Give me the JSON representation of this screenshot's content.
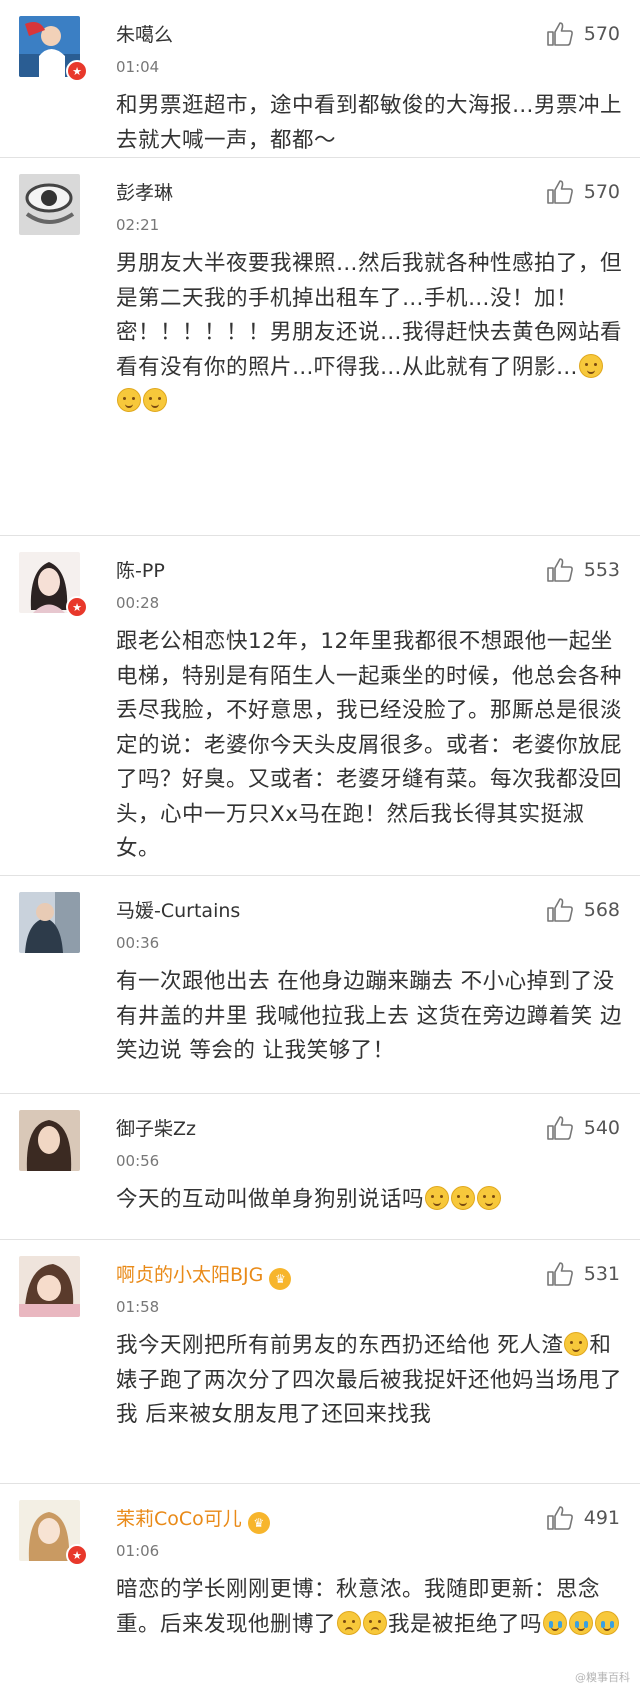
{
  "comments": [
    {
      "name": "朱噶么",
      "time": "01:04",
      "likes": "570",
      "text": "和男票逛超市，途中看到都敏俊的大海报…男票冲上去就大喊一声，都都～",
      "verified": true,
      "crown": false,
      "emoji_count": 0
    },
    {
      "name": "彭孝琳",
      "time": "02:21",
      "likes": "570",
      "text": "男朋友大半夜要我裸照…然后我就各种性感拍了，但是第二天我的手机掉出租车了…手机…没！加！密！！！！！！男朋友还说…我得赶快去黄色网站看看有没有你的照片…吓得我…从此就有了阴影…",
      "verified": false,
      "crown": false,
      "emoji_count": 3
    },
    {
      "name": "陈-PP",
      "time": "00:28",
      "likes": "553",
      "text": "跟老公相恋快12年，12年里我都很不想跟他一起坐电梯，特别是有陌生人一起乘坐的时候，他总会各种丢尽我脸，不好意思，我已经没脸了。那厮总是很淡定的说：老婆你今天头皮屑很多。或者：老婆你放屁了吗？好臭。又或者：老婆牙缝有菜。每次我都没回头，心中一万只Xx马在跑！然后我长得其实挺淑女。",
      "verified": true,
      "crown": false,
      "emoji_count": 0
    },
    {
      "name": "马媛-Curtains",
      "time": "00:36",
      "likes": "568",
      "text": "有一次跟他出去 在他身边蹦来蹦去 不小心掉到了没有井盖的井里  我喊他拉我上去  这货在旁边蹲着笑  边笑边说  等会的 让我笑够了！",
      "verified": false,
      "crown": false,
      "emoji_count": 0
    },
    {
      "name": "御子柴Zz",
      "time": "00:56",
      "likes": "540",
      "text": "今天的互动叫做单身狗别说话吗",
      "verified": false,
      "crown": false,
      "emoji_count": 3
    },
    {
      "name": "啊贞的小太阳BJG",
      "time": "01:58",
      "likes": "531",
      "text_a": "我今天刚把所有前男友的东西扔还给他 死人渣",
      "text_b": "和婊子跑了两次分了四次最后被我捉奸还他妈当场甩了我 后来被女朋友甩了还回来找我",
      "verified": false,
      "crown": true
    },
    {
      "name": "茉莉CoCo可儿",
      "time": "01:06",
      "likes": "491",
      "text_a": "暗恋的学长刚刚更博：秋意浓。我随即更新：思念重。后来发现他删博了",
      "text_b": "我是被拒绝了吗",
      "verified": true,
      "crown": true
    }
  ],
  "watermark": "@糗事百科"
}
